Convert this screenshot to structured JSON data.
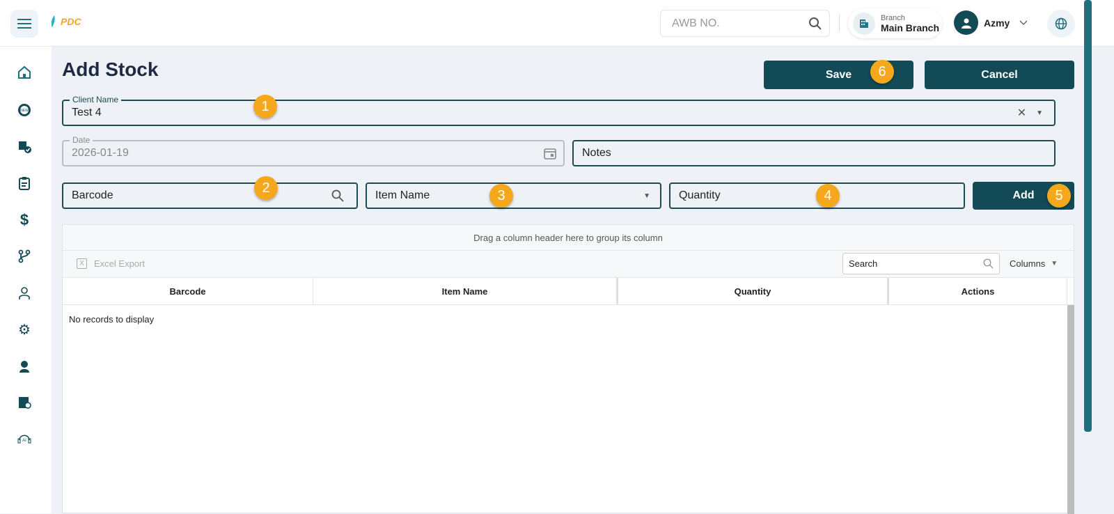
{
  "header": {
    "logo": "PDC",
    "awb_placeholder": "AWB NO.",
    "branch_label": "Branch",
    "branch_value": "Main Branch",
    "user_name": "Azmy"
  },
  "sidebar": {
    "items": [
      "home",
      "new",
      "packages",
      "orders",
      "finance",
      "branches",
      "users",
      "settings",
      "support-agent",
      "inventory",
      "ai-assistant"
    ]
  },
  "page": {
    "title": "Add Stock",
    "save": "Save",
    "cancel": "Cancel"
  },
  "form": {
    "client_label": "Client Name",
    "client_value": "Test 4",
    "date_label": "Date",
    "date_value": "2026-01-19",
    "notes_placeholder": "Notes",
    "barcode_placeholder": "Barcode",
    "item_placeholder": "Item Name",
    "quantity_placeholder": "Quantity",
    "add": "Add"
  },
  "badges": [
    "1",
    "2",
    "3",
    "4",
    "5",
    "6"
  ],
  "grid": {
    "group_hint": "Drag a column header here to group its column",
    "excel_export": "Excel Export",
    "search_placeholder": "Search",
    "columns": "Columns",
    "headers": [
      "Barcode",
      "Item Name",
      "Quantity",
      "Actions"
    ],
    "empty": "No records to display"
  },
  "colors": {
    "primary": "#124a55",
    "accent": "#f5a81c"
  }
}
